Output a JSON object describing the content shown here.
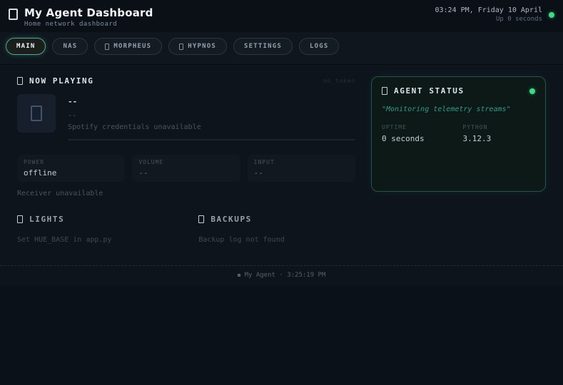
{
  "header": {
    "title": "My Agent Dashboard",
    "subtitle": "Home network dashboard",
    "clock": "03:24 PM, Friday 10 April",
    "uptime": "Up 0 seconds"
  },
  "tabs": [
    {
      "label": "MAIN",
      "active": true
    },
    {
      "label": "NAS",
      "active": false
    },
    {
      "label": "MORPHEUS",
      "active": false,
      "icon": "box-glyph"
    },
    {
      "label": "HYPNOS",
      "active": false,
      "icon": "box-glyph"
    },
    {
      "label": "SETTINGS",
      "active": false
    },
    {
      "label": "LOGS",
      "active": false
    }
  ],
  "now_playing": {
    "heading": "NOW PLAYING",
    "badge": "no_token",
    "track": "--",
    "artist": "--",
    "status": "Spotify credentials unavailable",
    "stats": [
      {
        "label": "POWER",
        "value": "offline"
      },
      {
        "label": "VOLUME",
        "value": "--"
      },
      {
        "label": "INPUT",
        "value": "--"
      }
    ],
    "note": "Receiver unavailable"
  },
  "agent_status": {
    "heading": "AGENT STATUS",
    "quote": "\"Monitoring telemetry streams\"",
    "stats": [
      {
        "label": "UPTIME",
        "value": "0 seconds"
      },
      {
        "label": "PYTHON",
        "value": "3.12.3"
      }
    ]
  },
  "lights": {
    "heading": "LIGHTS",
    "message": "Set HUE_BASE in app.py"
  },
  "backups": {
    "heading": "BACKUPS",
    "message": "Backup log not found"
  },
  "footer": {
    "text": "My Agent · 3:25:19 PM"
  },
  "colors": {
    "accent_teal": "#2f9a8a",
    "status_green": "#3ddc84",
    "panel_border": "#24564b",
    "background": "#0e141c"
  }
}
